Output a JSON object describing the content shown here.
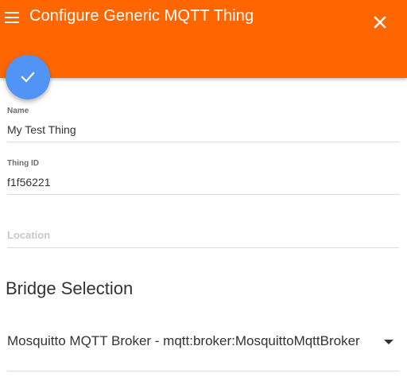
{
  "header": {
    "title": "Configure Generic MQTT Thing",
    "accent_color": "#ff6600",
    "menu_icon": "hamburger-menu-icon",
    "close_icon": "close-icon"
  },
  "fab": {
    "icon": "checkmark-icon",
    "color": "#5294f6"
  },
  "form": {
    "name": {
      "label": "Name",
      "value": "My Test Thing"
    },
    "thing_id": {
      "label": "Thing ID",
      "value": "f1f56221"
    },
    "location": {
      "label": "Location",
      "value": ""
    }
  },
  "bridge": {
    "section_title": "Bridge Selection",
    "selected": "Mosquitto MQTT Broker - mqtt:broker:MosquittoMqttBroker",
    "dropdown_icon": "caret-down-icon"
  }
}
